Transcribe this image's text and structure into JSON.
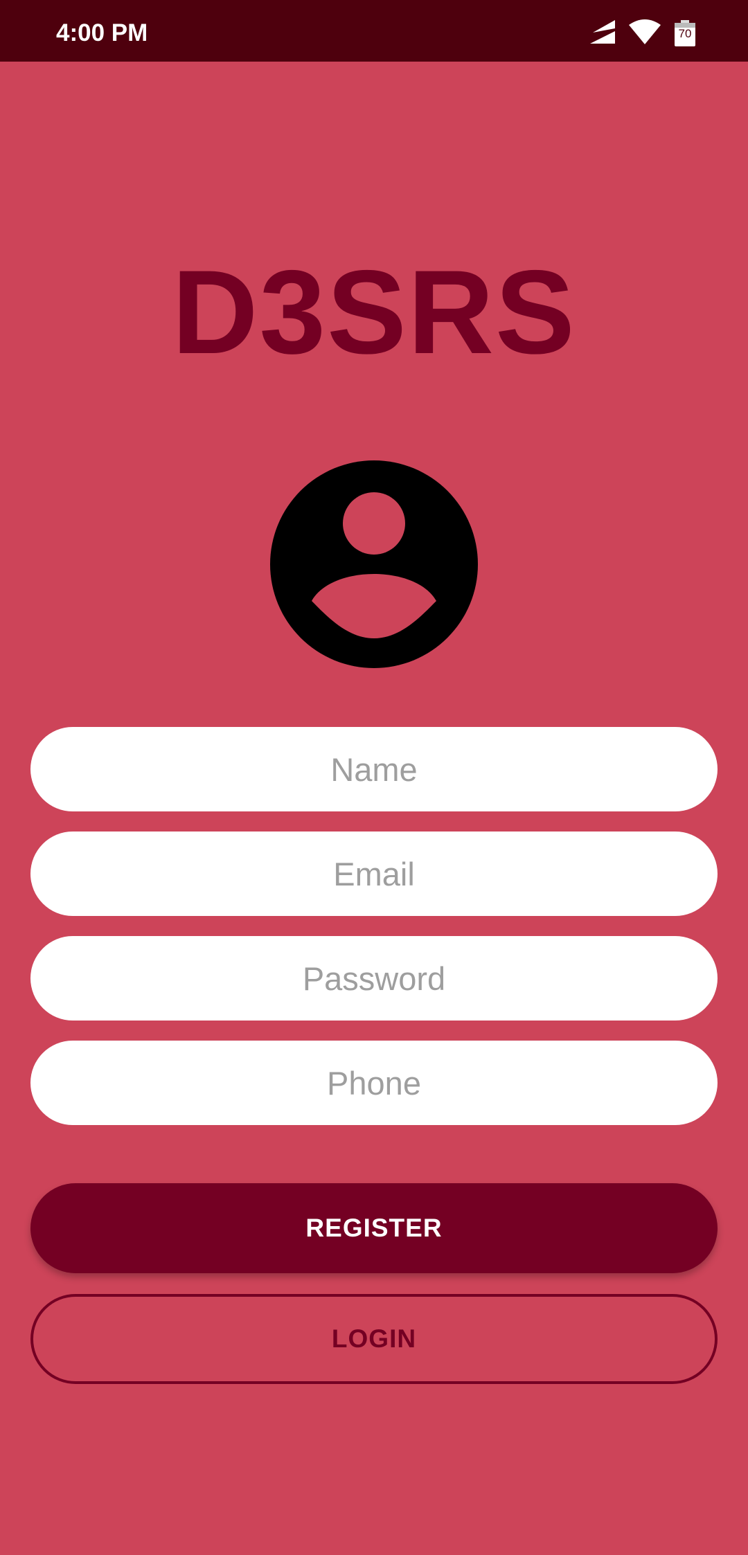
{
  "status_bar": {
    "time": "4:00 PM",
    "battery_level": "70",
    "icons": [
      "signal-icon",
      "wifi-icon",
      "battery-icon"
    ]
  },
  "app": {
    "title": "D3SRS"
  },
  "avatar": {
    "icon": "account-circle-icon"
  },
  "form": {
    "name_placeholder": "Name",
    "email_placeholder": "Email",
    "password_placeholder": "Password",
    "phone_placeholder": "Phone"
  },
  "actions": {
    "register_label": "REGISTER",
    "login_label": "LOGIN"
  },
  "colors": {
    "background": "#cd4459",
    "status_bar": "#4e000d",
    "accent": "#740023",
    "input_background": "#ffffff",
    "placeholder": "#9e9e9e"
  }
}
